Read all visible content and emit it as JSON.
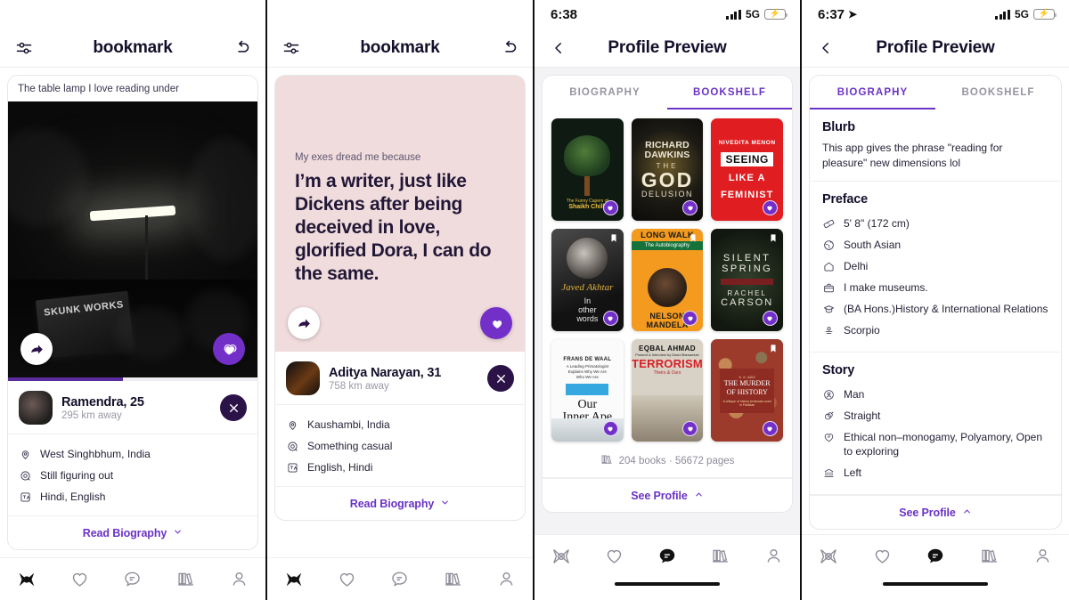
{
  "accent": "#6b33c6",
  "accent_dark": "#2b1247",
  "panels": [
    {
      "id": "bookmark-feed-1",
      "statusbar": {
        "visible": false,
        "time": "",
        "network": "",
        "location_arrow": false
      },
      "topbar": {
        "left_icon": "filter-sliders-icon",
        "title": "bookmark",
        "right_icon": "undo-icon"
      },
      "card": {
        "caption": "The table lamp I love reading under",
        "media_type": "photo",
        "photo_alt_text": "SKUNK WORKS",
        "share_icon": "share-icon",
        "like_icon": "heart-icon",
        "progress_percent": 46,
        "person": {
          "name": "Ramendra, 25",
          "distance": "295 km away",
          "close_icon": "close-icon"
        },
        "facts": [
          {
            "icon": "location-pin-icon",
            "text": "West Singhbhum, India"
          },
          {
            "icon": "target-icon",
            "text": "Still figuring out"
          },
          {
            "icon": "language-icon",
            "text": "Hindi, English"
          }
        ],
        "footer_label": "Read Biography",
        "footer_chevron": "chevron-down-icon"
      },
      "nav": {
        "active_index": 0
      },
      "home_indicator": false
    },
    {
      "id": "bookmark-feed-2",
      "statusbar": {
        "visible": false,
        "time": "",
        "network": "",
        "location_arrow": false
      },
      "topbar": {
        "left_icon": "filter-sliders-icon",
        "title": "bookmark",
        "right_icon": "undo-icon"
      },
      "card": {
        "caption": "",
        "media_type": "prompt",
        "prompt_label": "My exes dread me because",
        "prompt_text": "I’m a writer, just like Dickens after being deceived in love, glorified Dora, I can do the same.",
        "share_icon": "share-icon",
        "like_icon": "heart-icon",
        "progress_percent": 0,
        "person": {
          "name": "Aditya Narayan, 31",
          "distance": "758 km away",
          "close_icon": "close-icon"
        },
        "facts": [
          {
            "icon": "location-pin-icon",
            "text": "Kaushambi, India"
          },
          {
            "icon": "target-icon",
            "text": "Something casual"
          },
          {
            "icon": "language-icon",
            "text": "English, Hindi"
          }
        ],
        "footer_label": "Read Biography",
        "footer_chevron": "chevron-down-icon"
      },
      "nav": {
        "active_index": 0
      },
      "home_indicator": false
    },
    {
      "id": "profile-preview-bookshelf",
      "statusbar": {
        "visible": true,
        "time": "6:38",
        "network": "5G",
        "location_arrow": false
      },
      "topbar": {
        "left_icon": "back-chevron-icon",
        "title": "Profile Preview",
        "right_icon": ""
      },
      "tabs": [
        {
          "label": "BIOGRAPHY",
          "active": false
        },
        {
          "label": "BOOKSHELF",
          "active": true
        }
      ],
      "bookshelf": {
        "books": [
          {
            "title": "The Funny Capers of Shaikh Chilli",
            "cover": "cov-shaikh",
            "badge": "heart-icon"
          },
          {
            "title": "The God Delusion",
            "author": "Richard Dawkins",
            "cover": "cov-dawkins",
            "badge": "heart-icon"
          },
          {
            "title": "Seeing Like a Feminist",
            "author": "Nivedita Menon",
            "cover": "cov-seeing",
            "badge": "heart-icon"
          },
          {
            "title": "In Other Words",
            "author": "Javed Akhtar",
            "cover": "cov-javed",
            "badge": "heart-icon",
            "bookmark": true
          },
          {
            "title": "Long Walk to Freedom",
            "author": "Nelson Mandela",
            "cover": "cov-mandela",
            "badge": "heart-icon",
            "bookmark": true
          },
          {
            "title": "Silent Spring",
            "author": "Rachel Carson",
            "cover": "cov-silent",
            "badge": "heart-icon",
            "bookmark": true
          },
          {
            "title": "Our Inner Ape",
            "author": "Frans de Waal",
            "cover": "cov-ape",
            "badge": "heart-icon"
          },
          {
            "title": "Terrorism: Theirs & Ours",
            "author": "Eqbal Ahmad",
            "cover": "cov-terror",
            "badge": "heart-icon"
          },
          {
            "title": "The Murder of History",
            "author": "K. K. Aziz",
            "cover": "cov-murder",
            "badge": "heart-icon",
            "bookmark": true
          }
        ],
        "stat_icon": "books-icon",
        "stat_text": "204 books · 56672 pages"
      },
      "footer_label": "See Profile",
      "footer_chevron": "chevron-up-icon",
      "nav": {
        "active_index": 2
      },
      "home_indicator": true
    },
    {
      "id": "profile-preview-biography",
      "statusbar": {
        "visible": true,
        "time": "6:37",
        "network": "5G",
        "location_arrow": true
      },
      "topbar": {
        "left_icon": "back-chevron-icon",
        "title": "Profile Preview",
        "right_icon": ""
      },
      "tabs": [
        {
          "label": "BIOGRAPHY",
          "active": true
        },
        {
          "label": "BOOKSHELF",
          "active": false
        }
      ],
      "biography": {
        "sections": [
          {
            "heading": "Blurb",
            "paragraph": "This app gives the phrase \"reading for pleasure\" new dimensions lol",
            "items": []
          },
          {
            "heading": "Preface",
            "paragraph": "",
            "items": [
              {
                "icon": "ruler-icon",
                "text": "5' 8\" (172 cm)"
              },
              {
                "icon": "globe-icon",
                "text": "South Asian"
              },
              {
                "icon": "home-icon",
                "text": "Delhi"
              },
              {
                "icon": "briefcase-icon",
                "text": "I make museums."
              },
              {
                "icon": "graduation-cap-icon",
                "text": "(BA Hons.)History & International Relations"
              },
              {
                "icon": "zodiac-icon",
                "text": "Scorpio"
              }
            ]
          },
          {
            "heading": "Story",
            "paragraph": "",
            "items": [
              {
                "icon": "person-circle-icon",
                "text": "Man"
              },
              {
                "icon": "orientation-icon",
                "text": "Straight"
              },
              {
                "icon": "heart-outline-icon",
                "text": "Ethical non–monogamy, Polyamory, Open to exploring"
              },
              {
                "icon": "politics-icon",
                "text": "Left"
              }
            ]
          }
        ]
      },
      "footer_label": "See Profile",
      "footer_chevron": "chevron-up-icon",
      "nav": {
        "active_index": 3
      },
      "home_indicator": true
    }
  ],
  "nav_items": [
    {
      "icon": "bookmark-logo-icon",
      "name": "nav-discover"
    },
    {
      "icon": "heart-icon",
      "name": "nav-likes"
    },
    {
      "icon": "chat-icon",
      "name": "nav-messages"
    },
    {
      "icon": "books-icon",
      "name": "nav-bookshelf"
    },
    {
      "icon": "person-icon",
      "name": "nav-profile"
    }
  ]
}
